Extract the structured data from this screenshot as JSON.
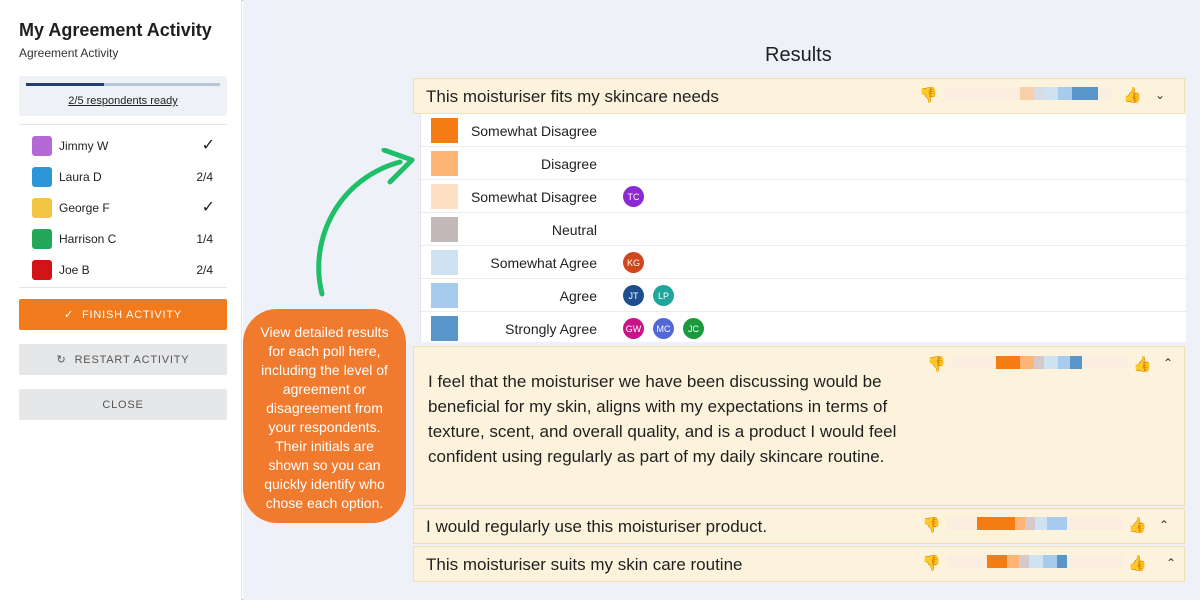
{
  "sidebar": {
    "title": "My Agreement Activity",
    "subtitle": "Agreement Activity",
    "progress": {
      "text": "2/5 respondents ready",
      "fraction": 0.4
    },
    "respondents": [
      {
        "name": "Jimmy W",
        "color": "#b36ad6",
        "status": "✓",
        "check": true
      },
      {
        "name": "Laura D",
        "color": "#2d96d8",
        "status": "2/4",
        "check": false
      },
      {
        "name": "George F",
        "color": "#f4c542",
        "status": "✓",
        "check": true
      },
      {
        "name": "Harrison C",
        "color": "#23a85a",
        "status": "1/4",
        "check": false
      },
      {
        "name": "Joe B",
        "color": "#d21418",
        "status": "2/4",
        "check": false
      }
    ],
    "buttons": {
      "finish": "FINISH ACTIVITY",
      "restart": "RESTART ACTIVITY",
      "close": "CLOSE"
    }
  },
  "main": {
    "results_title": "Results",
    "polls": [
      {
        "text": "This moisturiser fits my skincare needs",
        "expanded": true
      },
      {
        "text": "I feel that the moisturiser we have been discussing would be beneficial for my skin, aligns with my expectations in terms of texture, scent, and overall quality, and is a product I would feel confident using regularly as part of my daily skincare routine.",
        "expanded": true
      },
      {
        "text": "I would regularly use this moisturiser product.",
        "expanded": false
      },
      {
        "text": "This moisturiser suits my skin care routine",
        "expanded": false
      }
    ],
    "options": [
      {
        "label": "Somewhat Disagree",
        "color": "#f47c12",
        "initials": []
      },
      {
        "label": "Disagree",
        "color": "#fdb474",
        "initials": []
      },
      {
        "label": "Somewhat Disagree",
        "color": "#fde0c2",
        "initials": [
          {
            "text": "TC",
            "color": "#8a2ad1"
          }
        ]
      },
      {
        "label": "Neutral",
        "color": "#c3b8b8",
        "initials": []
      },
      {
        "label": "Somewhat Agree",
        "color": "#cfe2f1",
        "initials": [
          {
            "text": "KG",
            "color": "#d2461e"
          }
        ]
      },
      {
        "label": "Agree",
        "color": "#a6cbec",
        "initials": [
          {
            "text": "JT",
            "color": "#1e4e8e"
          },
          {
            "text": "LP",
            "color": "#1fa59a"
          }
        ]
      },
      {
        "label": "Strongly Agree",
        "color": "#5895c8",
        "initials": [
          {
            "text": "GW",
            "color": "#c8138a"
          },
          {
            "text": "MC",
            "color": "#5367d6"
          },
          {
            "text": "JC",
            "color": "#1b9a3b"
          }
        ]
      }
    ],
    "callout": "View detailed results for each poll here, including the level of agreement or disagreement from your respondents. Their initials are shown so you can quickly identify who chose each option."
  },
  "icons": {
    "thumb_down": "thumbs-down-icon",
    "thumb_up": "thumbs-up-icon",
    "chevron_down": "chevron-down-icon",
    "chevron_up": "chevron-up-icon",
    "check": "check-icon",
    "restart": "restart-icon"
  },
  "colors": {
    "accent": "#f07a1c",
    "poll_background": "#fdf3dc",
    "agree_blue": "#3f8fd4"
  }
}
